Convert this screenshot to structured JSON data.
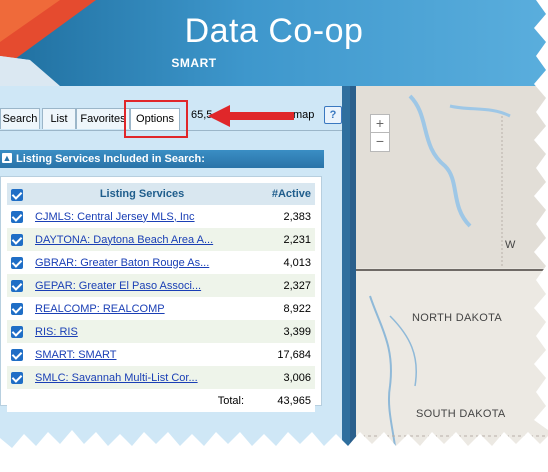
{
  "app": {
    "title": "Data Co-op",
    "subtitle": "SMART"
  },
  "tabs": [
    {
      "label": "Search",
      "active": false
    },
    {
      "label": "List",
      "active": false
    },
    {
      "label": "Favorites",
      "active": false
    },
    {
      "label": "Options",
      "active": true
    }
  ],
  "tabbar": {
    "count_text": "65,5",
    "map_label": "map",
    "help_label": "?"
  },
  "section": {
    "title": "Listing Services Included in Search:"
  },
  "table": {
    "headers": {
      "service": "Listing Services",
      "active": "#Active"
    },
    "rows": [
      {
        "service": "CJMLS: Central Jersey MLS, Inc",
        "active": "2,383"
      },
      {
        "service": "DAYTONA: Daytona Beach Area A...",
        "active": "2,231"
      },
      {
        "service": "GBRAR: Greater Baton Rouge As...",
        "active": "4,013"
      },
      {
        "service": "GEPAR: Greater El Paso Associ...",
        "active": "2,327"
      },
      {
        "service": "REALCOMP: REALCOMP",
        "active": "8,922"
      },
      {
        "service": "RIS: RIS",
        "active": "3,399"
      },
      {
        "service": "SMART: SMART",
        "active": "17,684"
      },
      {
        "service": "SMLC: Savannah Multi-List Cor...",
        "active": "3,006"
      }
    ],
    "total_label": "Total:",
    "total_value": "43,965"
  },
  "map": {
    "zoom_in": "+",
    "zoom_out": "−",
    "labels": {
      "north_dakota": "NORTH DAKOTA",
      "south_dakota": "SOUTH DAKOTA",
      "w": "W"
    }
  },
  "colors": {
    "accent_red": "#e0272a",
    "header_blue": "#2a73a8",
    "link_blue": "#1a3fb5"
  }
}
